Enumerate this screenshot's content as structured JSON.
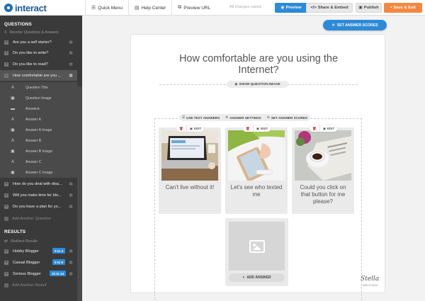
{
  "app": {
    "logo_text": "interact",
    "brand_color": "#1e5b93"
  },
  "topbar": {
    "links": [
      {
        "icon": "menu-icon",
        "label": "Quick Menu"
      },
      {
        "icon": "book-icon",
        "label": "Help Center"
      },
      {
        "icon": "external-link-icon",
        "label": "Preview URL"
      }
    ],
    "status": "All changes saved",
    "preview_label": "Preview",
    "share_label": "Share & Embed",
    "publish_label": "Publish",
    "save_label": "Save & Exit",
    "accent_color": "#2d8ad8",
    "save_color": "#f4883f"
  },
  "sidebar": {
    "questions_title": "QUESTIONS",
    "questions_sub": "Reorder Questions & Answers",
    "questions": [
      "Are you a self starter?",
      "Do you like to write?",
      "Do you like to read?",
      "How comfortable are you ...",
      "How do you deal with disa...",
      "Will you make time for blo...",
      "Do you have a plan for yo..."
    ],
    "active_index": 3,
    "sub_items": [
      {
        "icon": "text-a-icon",
        "label": "Question Title"
      },
      {
        "icon": "image-icon",
        "label": "Question Image"
      },
      {
        "icon": "list-icon",
        "label": "Answers"
      },
      {
        "icon": "text-a-icon",
        "label": "Answer A"
      },
      {
        "icon": "image-icon",
        "label": "Answer A Image"
      },
      {
        "icon": "text-a-icon",
        "label": "Answer B"
      },
      {
        "icon": "image-icon",
        "label": "Answer B Image"
      },
      {
        "icon": "text-a-icon",
        "label": "Answer C"
      },
      {
        "icon": "image-icon",
        "label": "Answer C Image"
      }
    ],
    "add_question": "Add Another Question",
    "results_title": "RESULTS",
    "results_sub": "Redirect Results",
    "results": [
      {
        "label": "Hobby Blogger",
        "range": "0 to 4"
      },
      {
        "label": "Casual Blogger",
        "range": "5 to 9"
      },
      {
        "label": "Serious Blogger",
        "range": "10 to 14"
      }
    ],
    "add_result": "Add Another Result"
  },
  "main": {
    "set_scores_label": "SET ANSWER SCORES",
    "question_title": "How comfortable are you using the Internet?",
    "show_image_label": "SHOW QUESTION IMAGE",
    "toolbar": {
      "text_answers": "USE TEXT ANSWERS",
      "answer_settings": "ANSWER SETTINGS",
      "answer_scores": "SET ANSWER SCORES"
    },
    "edit_label": "EDIT",
    "answers": [
      {
        "text": "Can't live without it!",
        "image": "laptop-desk-photo"
      },
      {
        "text": "Let's see who texted me",
        "image": "smartphone-hand-photo"
      },
      {
        "text": "Could you click on that button for me please?",
        "image": "coffee-newspaper-photo"
      }
    ],
    "add_answer_label": "ADD ANSWER",
    "watermark": "Stella",
    "watermark_sub": "AND STUDIO"
  }
}
